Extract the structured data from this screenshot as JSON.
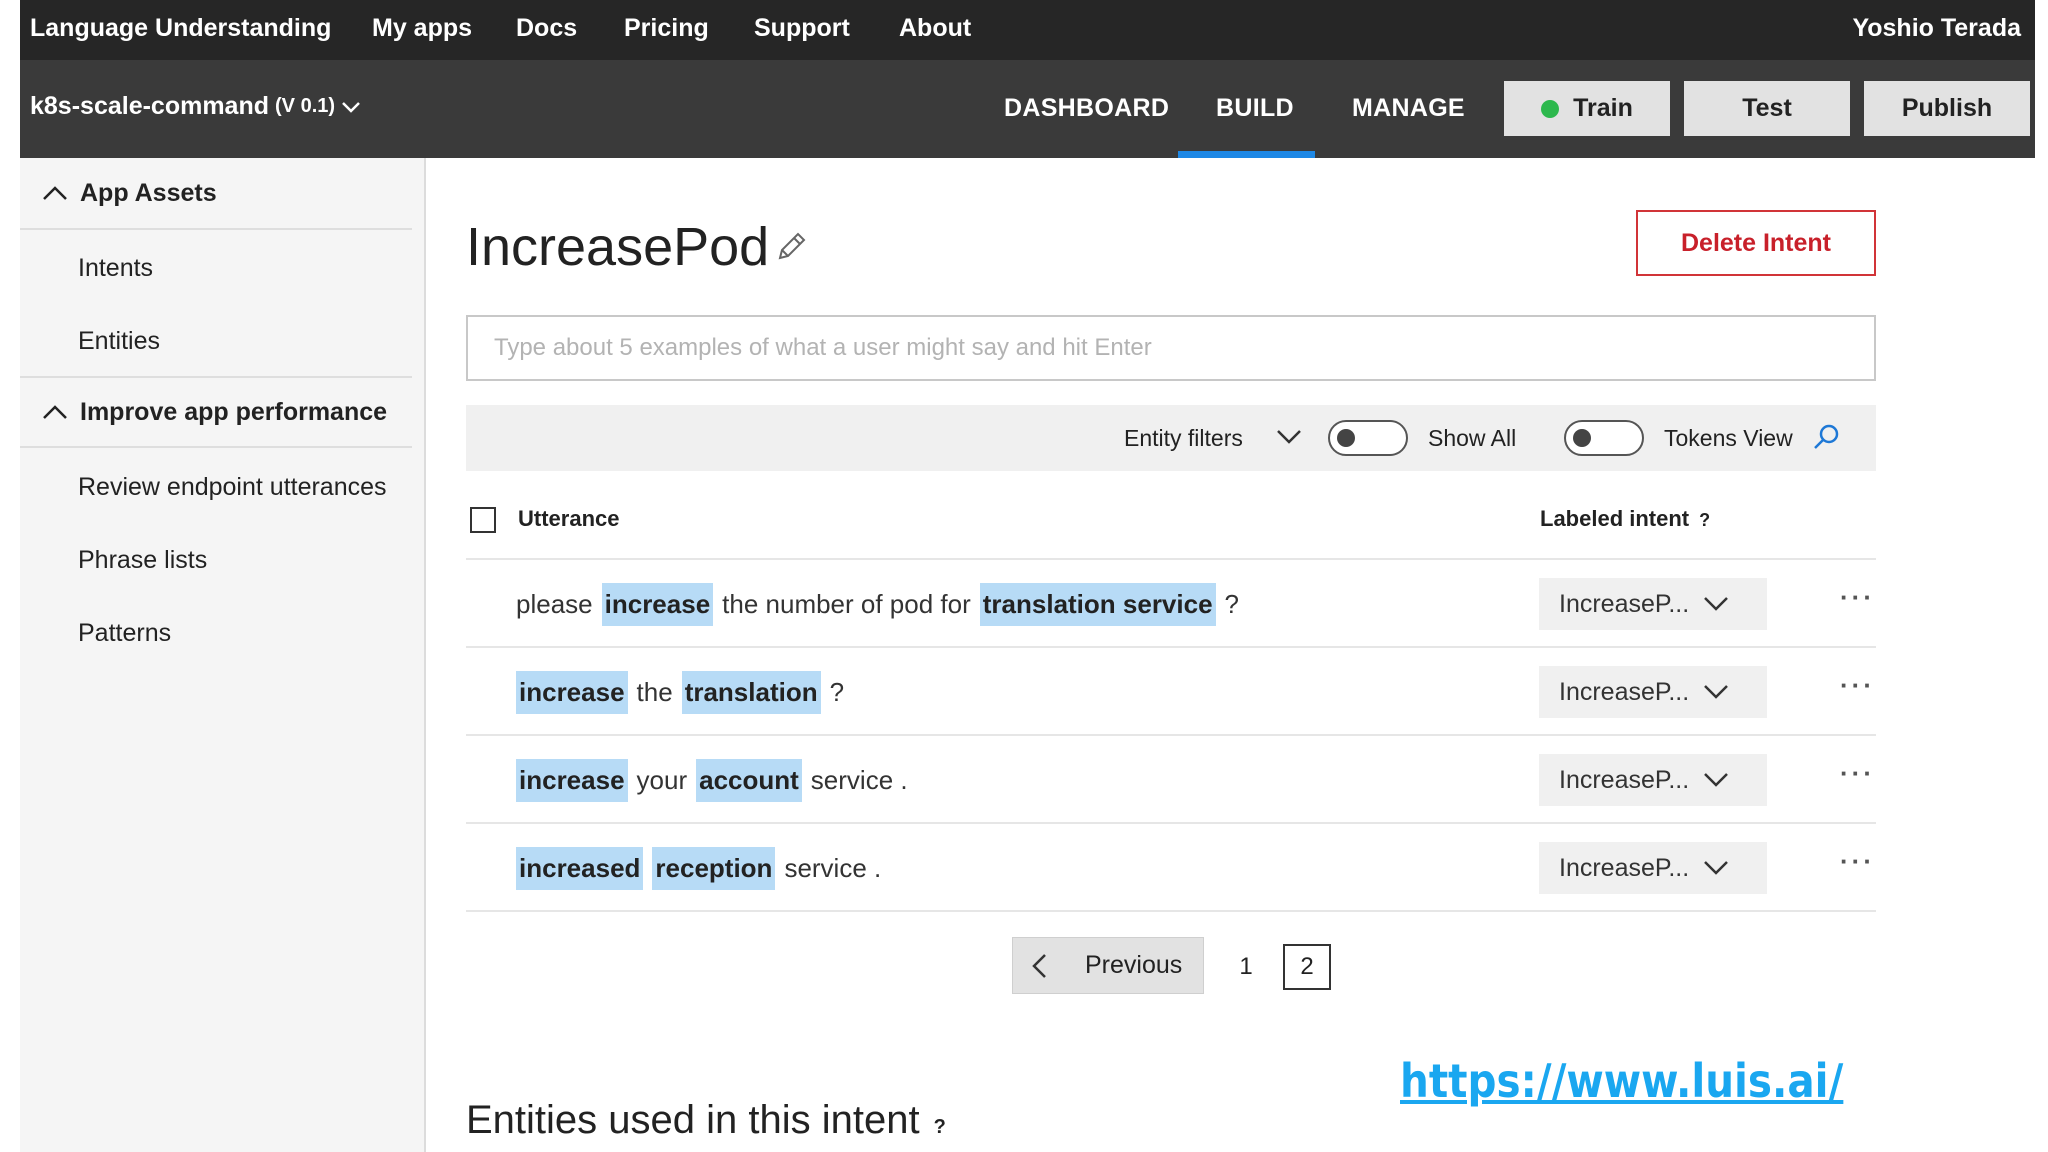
{
  "top_nav": {
    "brand": "Language Understanding",
    "links": [
      "My apps",
      "Docs",
      "Pricing",
      "Support",
      "About"
    ],
    "user": "Yoshio Terada"
  },
  "app_bar": {
    "app_name": "k8s-scale-command",
    "version": "(V 0.1)",
    "tabs": [
      "DASHBOARD",
      "BUILD",
      "MANAGE"
    ],
    "active_tab": "BUILD",
    "train_label": "Train",
    "test_label": "Test",
    "publish_label": "Publish",
    "train_status_color": "#2db84d"
  },
  "sidebar": {
    "section1": "App Assets",
    "section1_items": [
      "Intents",
      "Entities"
    ],
    "section2": "Improve app performance",
    "section2_items": [
      "Review endpoint utterances",
      "Phrase lists",
      "Patterns"
    ]
  },
  "intent": {
    "name": "IncreasePod",
    "delete_label": "Delete Intent",
    "input_placeholder": "Type about 5 examples of what a user might say and hit Enter"
  },
  "filters": {
    "entity_filters": "Entity filters",
    "show_all": "Show All",
    "tokens_view": "Tokens View"
  },
  "table": {
    "col_utterance": "Utterance",
    "col_labeled_intent": "Labeled intent",
    "help": "?",
    "more": "···",
    "rows": [
      {
        "tokens": [
          {
            "t": "please",
            "e": false
          },
          {
            "t": "increase",
            "e": true
          },
          {
            "t": "the number of pod for",
            "e": false
          },
          {
            "t": "translation service",
            "e": true
          },
          {
            "t": "?",
            "e": false
          }
        ],
        "intent": "IncreaseP..."
      },
      {
        "tokens": [
          {
            "t": "increase",
            "e": true
          },
          {
            "t": "the",
            "e": false
          },
          {
            "t": "translation",
            "e": true
          },
          {
            "t": "?",
            "e": false
          }
        ],
        "intent": "IncreaseP..."
      },
      {
        "tokens": [
          {
            "t": "increase",
            "e": true
          },
          {
            "t": "your",
            "e": false
          },
          {
            "t": "account",
            "e": true
          },
          {
            "t": "service .",
            "e": false
          }
        ],
        "intent": "IncreaseP..."
      },
      {
        "tokens": [
          {
            "t": "increased",
            "e": true
          },
          {
            "t": "reception",
            "e": true
          },
          {
            "t": "service .",
            "e": false
          }
        ],
        "intent": "IncreaseP..."
      }
    ]
  },
  "pagination": {
    "previous": "Previous",
    "pages": [
      "1",
      "2"
    ],
    "current_page": "2"
  },
  "entities_section": {
    "title": "Entities used in this intent",
    "help": "?"
  },
  "overlay": {
    "url": "https://www.luis.ai/"
  },
  "colors": {
    "entity_highlight": "#b7dbf6",
    "accent": "#1e88e5",
    "delete_red": "#c8202a"
  }
}
